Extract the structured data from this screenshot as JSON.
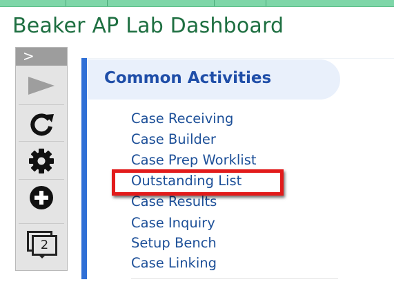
{
  "window": {
    "title": "Beaker AP Lab Dashboard"
  },
  "toolbar": {
    "expand_label": ">",
    "icons": [
      "play-icon",
      "refresh-icon",
      "settings-icon",
      "add-icon",
      "windows-icon"
    ],
    "window_count": "2"
  },
  "panel": {
    "header": "Common Activities",
    "activities": [
      "Case Receiving",
      "Case Builder",
      "Case Prep Worklist",
      "Outstanding List",
      "Case Results",
      "Case Inquiry",
      "Setup Bench",
      "Case Linking"
    ],
    "highlighted": "Outstanding List"
  },
  "colors": {
    "title": "#1e6f41",
    "accent_bar": "#2f6fd6",
    "link": "#1c4f98",
    "highlight_border": "#e21b1b"
  }
}
